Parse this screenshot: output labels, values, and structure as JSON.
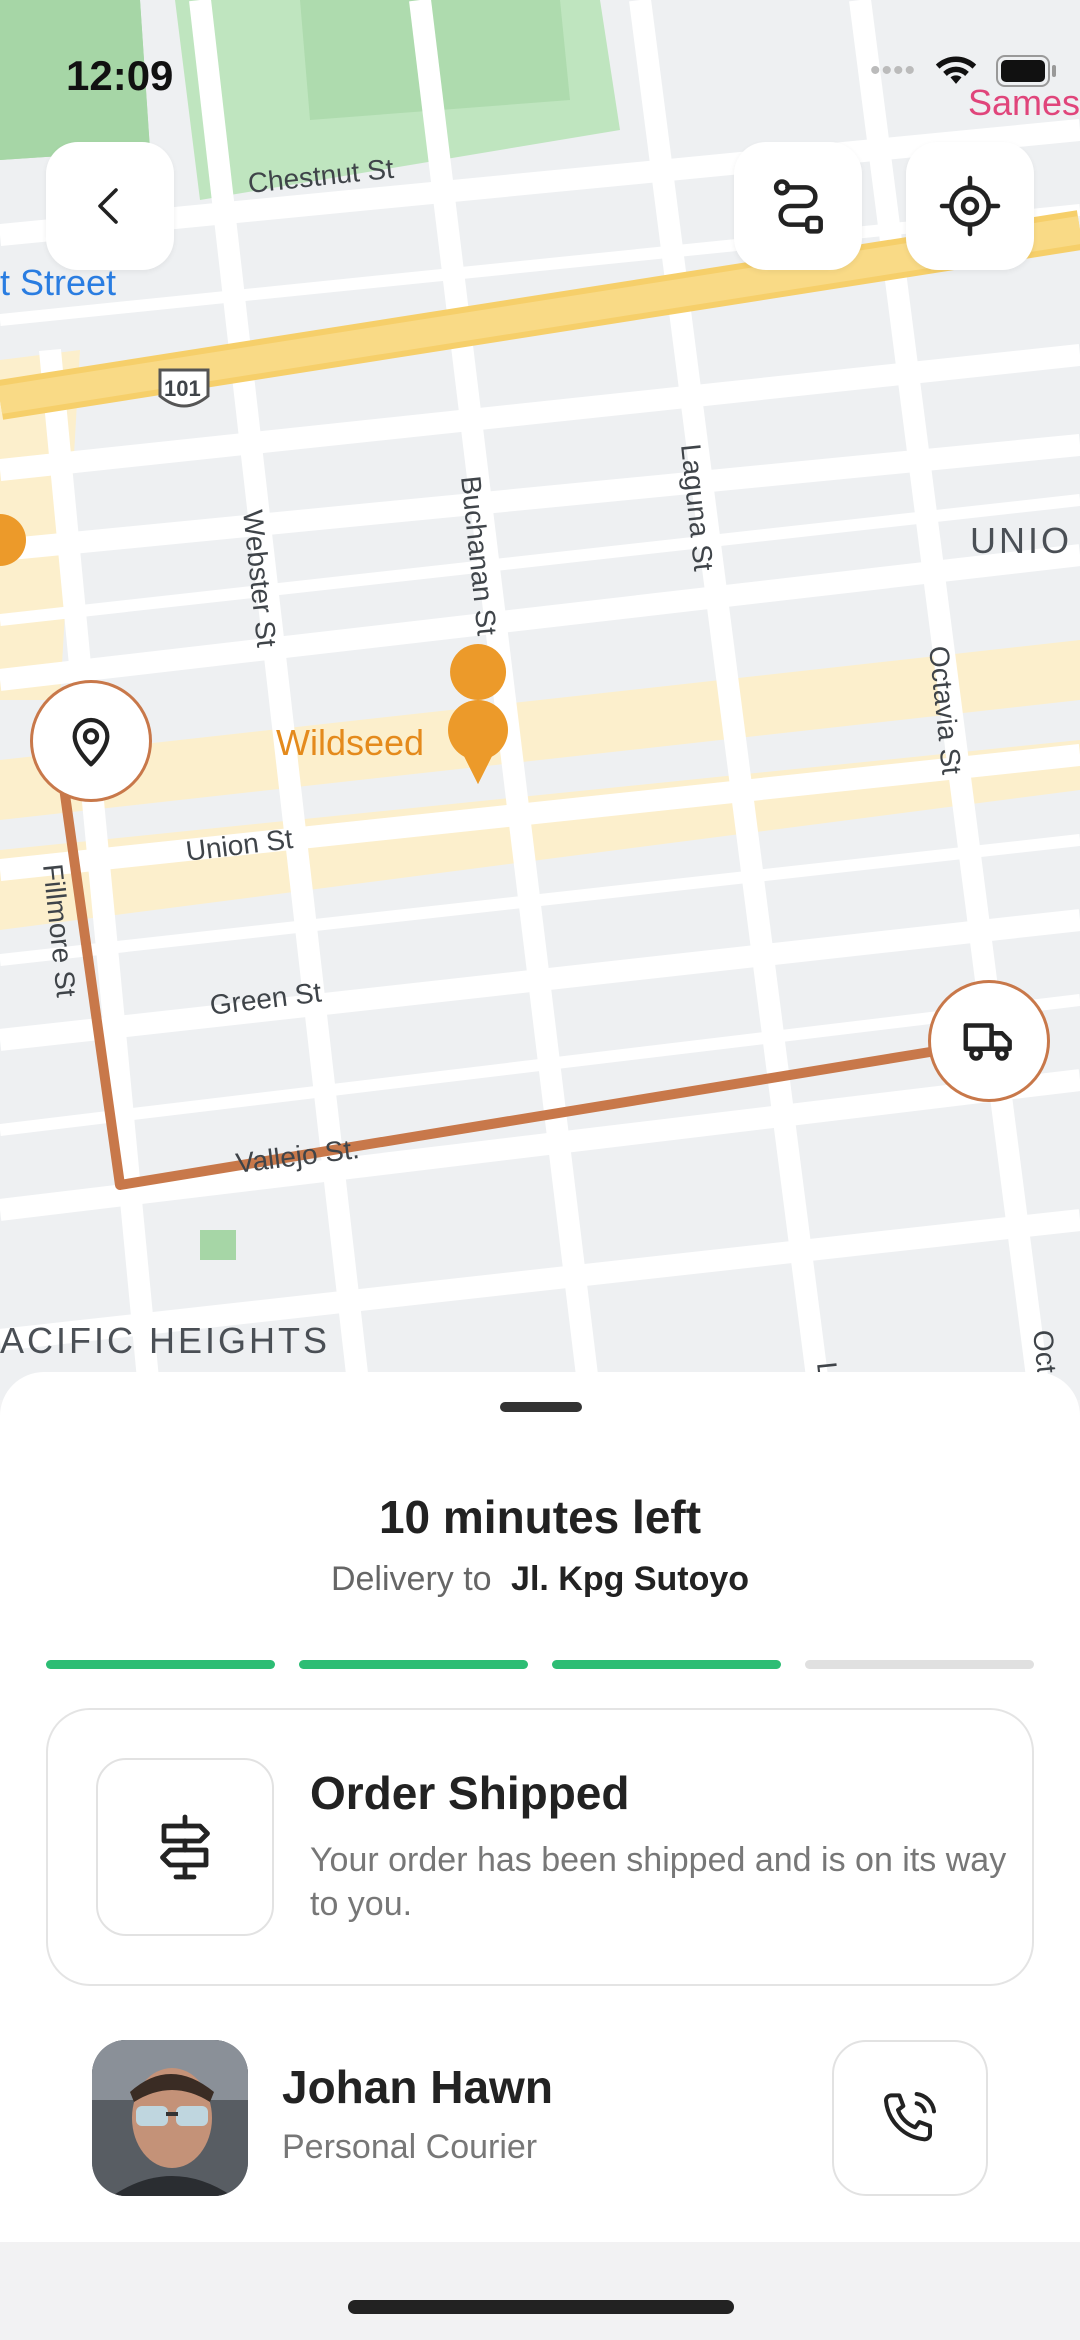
{
  "status_bar": {
    "time": "12:09",
    "carrier_text": "Sames"
  },
  "map": {
    "streets": {
      "chestnut": "Chestnut St",
      "lombard_partial": "t Street",
      "hwy": "101",
      "webster": "Webster St",
      "buchanan": "Buchanan St",
      "laguna": "Laguna St",
      "octavia": "Octavia St",
      "union": "Union St",
      "green": "Green St",
      "vallejo": "Vallejo St.",
      "fillmore": "Fillmore St",
      "laguna_bottom": "La",
      "octavia_bottom": "Octa"
    },
    "areas": {
      "union_partial": "UNIO",
      "pacific_heights": "ACIFIC HEIGHTS"
    },
    "poi": {
      "name": "Wildseed"
    },
    "route_color": "#c8784a"
  },
  "controls": {
    "back_icon": "chevron-left-icon",
    "route_icon": "route-icon",
    "locate_icon": "crosshair-icon"
  },
  "sheet": {
    "eta": "10 minutes left",
    "delivery_prefix": "Delivery to",
    "delivery_address": "Jl. Kpg Sutoyo",
    "progress": {
      "total_steps": 4,
      "completed_steps": 3,
      "done_color": "#2dbd74"
    },
    "status": {
      "title": "Order Shipped",
      "description": "Your order has been shipped and is on its way to you.",
      "icon": "signpost-icon"
    },
    "courier": {
      "name": "Johan Hawn",
      "role": "Personal Courier",
      "call_icon": "phone-call-icon"
    }
  }
}
